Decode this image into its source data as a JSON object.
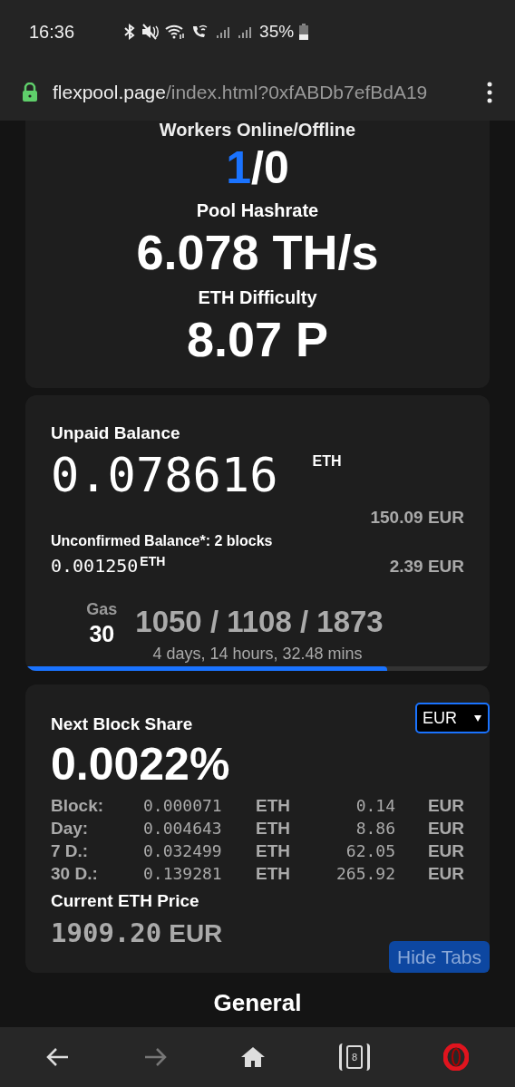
{
  "status_bar": {
    "time": "16:36",
    "battery": "35%"
  },
  "address_bar": {
    "domain": "flexpool.page",
    "path": "/index.html?0xfABDb7efBdA19"
  },
  "stats_card": {
    "workers_label": "Workers Online/Offline",
    "workers_online": "1",
    "workers_offline": "/0",
    "hashrate_label": "Pool Hashrate",
    "hashrate": "6.078 TH/s",
    "difficulty_label": "ETH Difficulty",
    "difficulty": "8.07 P"
  },
  "balance_card": {
    "title": "Unpaid Balance",
    "amount": "0.078616",
    "unit": "ETH",
    "fiat": "150.09 EUR",
    "unconfirmed_label": "Unconfirmed Balance*: 2 blocks",
    "unconfirmed_amount": "0.001250",
    "unconfirmed_unit": "ETH",
    "unconfirmed_fiat": "2.39 EUR",
    "gas_label": "Gas",
    "gas": "30",
    "gas_prices": "1050 / 1108 / 1873",
    "payout_eta": "4 days, 14 hours, 32.48 mins",
    "progress": {
      "level": 0.78
    }
  },
  "share_card": {
    "title": "Next Block Share",
    "currency": "EUR",
    "share": "0.0022%",
    "rows": [
      {
        "label": "Block:",
        "eth": "0.000071",
        "eth_unit": "ETH",
        "fiat": "0.14",
        "fiat_unit": "EUR"
      },
      {
        "label": "Day:",
        "eth": "0.004643",
        "eth_unit": "ETH",
        "fiat": "8.86",
        "fiat_unit": "EUR"
      },
      {
        "label": "7 D.:",
        "eth": "0.032499",
        "eth_unit": "ETH",
        "fiat": "62.05",
        "fiat_unit": "EUR"
      },
      {
        "label": "30 D.:",
        "eth": "0.139281",
        "eth_unit": "ETH",
        "fiat": "265.92",
        "fiat_unit": "EUR"
      }
    ],
    "price_label": "Current ETH Price",
    "price": "1909.20",
    "price_unit": "EUR",
    "hide_tabs_button": "Hide Tabs"
  },
  "section_heading": "General",
  "bottom_nav": {
    "tabs_count": "8"
  }
}
